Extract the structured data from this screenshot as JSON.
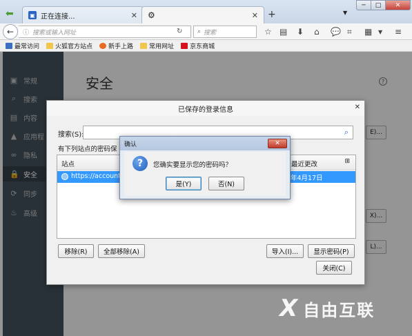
{
  "tabs": [
    {
      "title": "正在连接..."
    },
    {
      "title": ""
    }
  ],
  "navbar": {
    "url_placeholder": "搜索或输入网址",
    "search_placeholder": "搜索"
  },
  "bookmarks": [
    {
      "label": "最常访问",
      "icon": "bookmark-folder-icon"
    },
    {
      "label": "火狐官方站点",
      "icon": "folder-icon"
    },
    {
      "label": "新手上路",
      "icon": "firefox-icon"
    },
    {
      "label": "常用网址",
      "icon": "folder-icon"
    },
    {
      "label": "京东商城",
      "icon": "jd-icon"
    }
  ],
  "prefs": {
    "title": "安全",
    "sidebar": [
      {
        "label": "常规",
        "icon": "general-icon"
      },
      {
        "label": "搜索",
        "icon": "search-icon"
      },
      {
        "label": "内容",
        "icon": "content-icon"
      },
      {
        "label": "应用程",
        "icon": "applications-icon"
      },
      {
        "label": "隐私",
        "icon": "privacy-mask-icon"
      },
      {
        "label": "安全",
        "icon": "lock-icon"
      },
      {
        "label": "同步",
        "icon": "sync-icon"
      },
      {
        "label": "高级",
        "icon": "advanced-icon"
      }
    ],
    "side_buttons": [
      "E)...",
      "X)...",
      "L)..."
    ]
  },
  "logins_dialog": {
    "title": "已保存的登录信息",
    "search_label": "搜索(S):",
    "list_caption": "有下列站点的密码保",
    "col_site": "站点",
    "col_changed": "最近更改",
    "row": {
      "site": "https://accounts.fir",
      "date": "年4月17日"
    },
    "buttons": {
      "remove": "移除(R)",
      "remove_all": "全部移除(A)",
      "import": "导入(I)...",
      "show_passwords": "显示密码(P)",
      "close": "关闭(C)"
    }
  },
  "confirm": {
    "title": "确认",
    "message": "您确实要显示您的密码吗？",
    "yes": "是(Y)",
    "no": "否(N)"
  },
  "watermark": {
    "text": "自由互联"
  },
  "colors": {
    "sidebar": "#424f5a",
    "selection": "#3399ff",
    "close_red": "#c5443a"
  }
}
